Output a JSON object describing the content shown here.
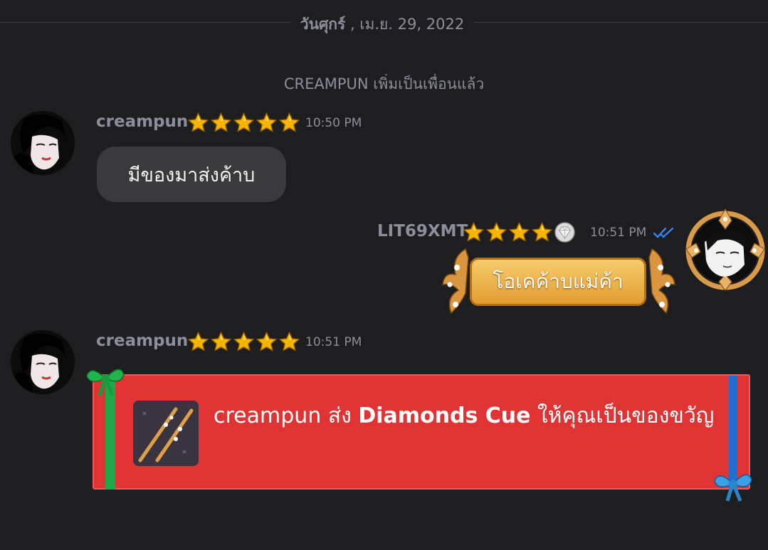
{
  "date_separator": {
    "day": "วันศุกร์",
    "date": " , เม.ย. 29, 2022"
  },
  "system_message": "CREAMPUN เพิ่มเป็นเพื่อนแล้ว",
  "messages": [
    {
      "sender": "creampun",
      "time": "10:50 PM",
      "text": "มีของมาส่งค้าบ"
    },
    {
      "sender": "LIT69XMT",
      "time": "10:51 PM",
      "text": "โอเคค้าบแม่ค้า"
    },
    {
      "sender": "creampun",
      "time": "10:51 PM",
      "gift": {
        "prefix": "creampun ส่ง ",
        "item": "Diamonds Cue",
        "suffix": " ให้คุณเป็นของขวัญ"
      }
    }
  ],
  "colors": {
    "background": "#1e1e20",
    "bubble_in": "#3a3a3c",
    "gift_card": "#e03434",
    "read_check": "#3b82f6",
    "star": "#f5b400"
  },
  "icons": {
    "star": "star-icon",
    "diamond_star": "diamond-star-icon",
    "read_receipt": "double-check-icon"
  }
}
